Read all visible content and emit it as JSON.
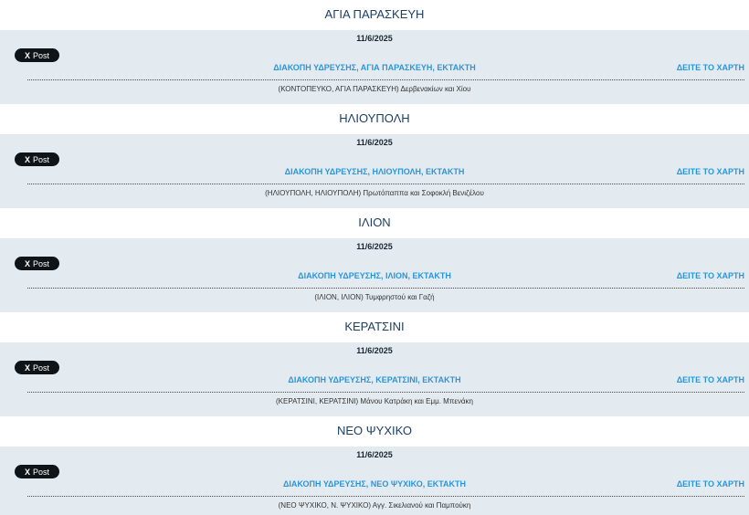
{
  "post_label": "Post",
  "post_logo": "X",
  "items": [
    {
      "area": "ΑΓΙΑ ΠΑΡΑΣΚΕΥΗ",
      "date": "11/6/2025",
      "headline": "ΔΙΑΚΟΠΗ ΥΔΡΕΥΣΗΣ, ΑΓΙΑ ΠΑΡΑΣΚΕΥΗ, ΕΚΤΑΚΤΗ",
      "map_link": "ΔΕΙΤΕ ΤΟ ΧΑΡΤΗ",
      "streets": "(ΚΟΝΤΟΠΕΥΚΟ, ΑΓΙΑ ΠΑΡΑΣΚΕΥΗ) Δερβενακίων και Χίου"
    },
    {
      "area": "ΗΛΙΟΥΠΟΛΗ",
      "date": "11/6/2025",
      "headline": "ΔΙΑΚΟΠΗ ΥΔΡΕΥΣΗΣ, ΗΛΙΟΥΠΟΛΗ, ΕΚΤΑΚΤΗ",
      "map_link": "ΔΕΙΤΕ ΤΟ ΧΑΡΤΗ",
      "streets": "(ΗΛΙΟΥΠΟΛΗ, ΗΛΙΟΥΠΟΛΗ) Πρωτόπαππα και Σοφοκλή Βενιζέλου"
    },
    {
      "area": "ΙΛΙΟΝ",
      "date": "11/6/2025",
      "headline": "ΔΙΑΚΟΠΗ ΥΔΡΕΥΣΗΣ, ΙΛΙΟΝ, ΕΚΤΑΚΤΗ",
      "map_link": "ΔΕΙΤΕ ΤΟ ΧΑΡΤΗ",
      "streets": "(ΙΛΙΟΝ, ΙΛΙΟΝ) Τυμφρηστού και Γαζή"
    },
    {
      "area": "ΚΕΡΑΤΣΙΝΙ",
      "date": "11/6/2025",
      "headline": "ΔΙΑΚΟΠΗ ΥΔΡΕΥΣΗΣ, ΚΕΡΑΤΣΙΝΙ, ΕΚΤΑΚΤΗ",
      "map_link": "ΔΕΙΤΕ ΤΟ ΧΑΡΤΗ",
      "streets": "(ΚΕΡΑΤΣΙΝΙ, ΚΕΡΑΤΣΙΝΙ) Μάνου Κατράκη και Εμμ. Μπενάκη"
    },
    {
      "area": "ΝΕΟ ΨΥΧΙΚΟ",
      "date": "11/6/2025",
      "headline": "ΔΙΑΚΟΠΗ ΥΔΡΕΥΣΗΣ, ΝΕΟ ΨΥΧΙΚΟ, ΕΚΤΑΚΤΗ",
      "map_link": "ΔΕΙΤΕ ΤΟ ΧΑΡΤΗ",
      "streets": "(ΝΕΟ ΨΥΧΙΚΟ, Ν. ΨΥΧΙΚΟ) Αγγ. Σικελιανού και Παμπούκη"
    }
  ]
}
